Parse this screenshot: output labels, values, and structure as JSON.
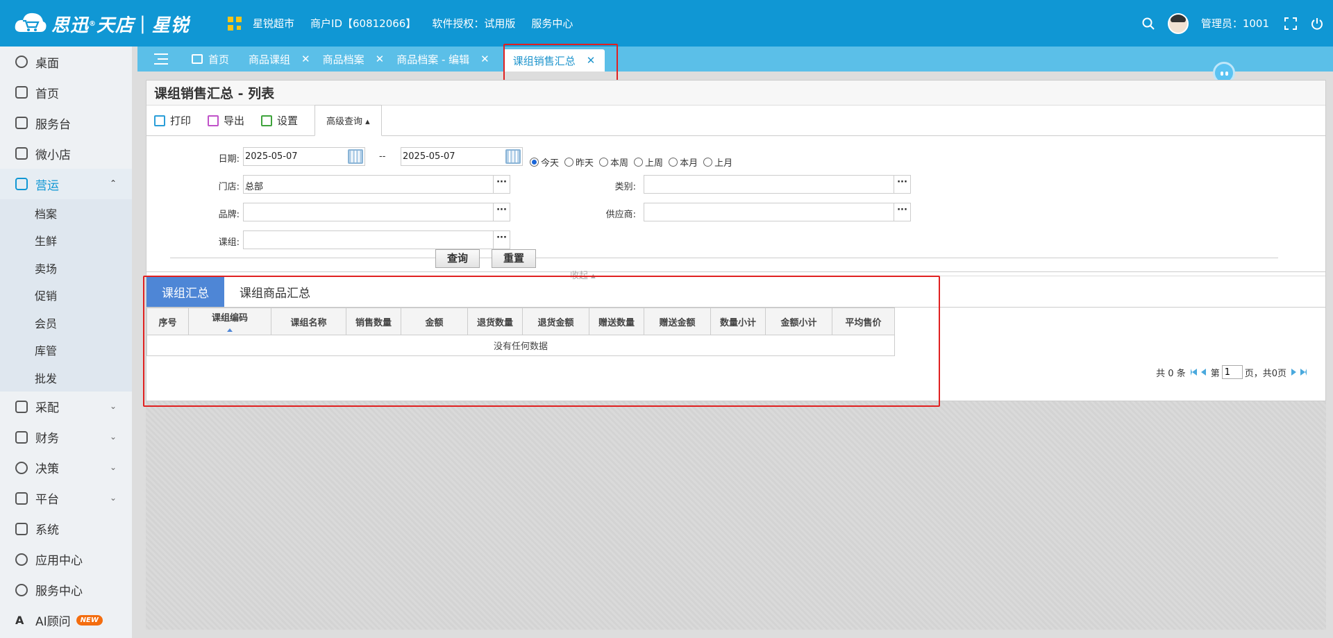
{
  "brand": {
    "logo_main": "思迅",
    "logo_tm": "®",
    "logo_sub": "天店",
    "logo_sep": "|",
    "logo_product": "星锐"
  },
  "topnav": {
    "store": "星锐超市",
    "merchant": "商户ID【60812066】",
    "license": "软件授权：试用版",
    "service": "服务中心"
  },
  "user": {
    "label": "管理员：1001"
  },
  "sidebar": {
    "items": [
      {
        "label": "桌面"
      },
      {
        "label": "首页"
      },
      {
        "label": "服务台"
      },
      {
        "label": "微小店"
      },
      {
        "label": "营运"
      }
    ],
    "sub_items": [
      "档案",
      "生鲜",
      "卖场",
      "促销",
      "会员",
      "库管",
      "批发"
    ],
    "more_items": [
      {
        "label": "采配"
      },
      {
        "label": "财务"
      },
      {
        "label": "决策"
      },
      {
        "label": "平台"
      },
      {
        "label": "系统"
      },
      {
        "label": "应用中心"
      },
      {
        "label": "服务中心"
      },
      {
        "label": "AI顾问"
      }
    ],
    "new_badge": "NEW"
  },
  "tabs": [
    "首页",
    "商品课组",
    "商品档案",
    "商品档案 - 编辑",
    "课组销售汇总"
  ],
  "page": {
    "title": "课组销售汇总 - 列表"
  },
  "toolbar": {
    "print": "打印",
    "export": "导出",
    "settings": "设置",
    "advanced": "高级查询 ▴"
  },
  "form": {
    "date_label": "日期:",
    "date_from": "2025-05-07",
    "date_sep": "--",
    "date_to": "2025-05-07",
    "radios": [
      "今天",
      "昨天",
      "本周",
      "上周",
      "本月",
      "上月"
    ],
    "store_label": "门店:",
    "store_value": "总部",
    "category_label": "类别:",
    "brand_label": "品牌:",
    "supplier_label": "供应商:",
    "group_label": "课组:",
    "query_btn": "查询",
    "reset_btn": "重置",
    "collapse": "收起 ▴"
  },
  "subtabs": [
    "课组汇总",
    "课组商品汇总"
  ],
  "grid": {
    "columns": [
      "序号",
      "课组编码",
      "课组名称",
      "销售数量",
      "金额",
      "退货数量",
      "退货金额",
      "赠送数量",
      "赠送金额",
      "数量小计",
      "金额小计",
      "平均售价"
    ],
    "empty": "没有任何数据"
  },
  "pager": {
    "total": "共 0 条",
    "page_prefix": "第",
    "page": "1",
    "page_suffix": "页，共0页"
  },
  "colors": {
    "topbar": "#1097d4",
    "tabstrip": "#5bbfe8",
    "active_subtab": "#4e86d6",
    "highlight": "#e02020"
  }
}
